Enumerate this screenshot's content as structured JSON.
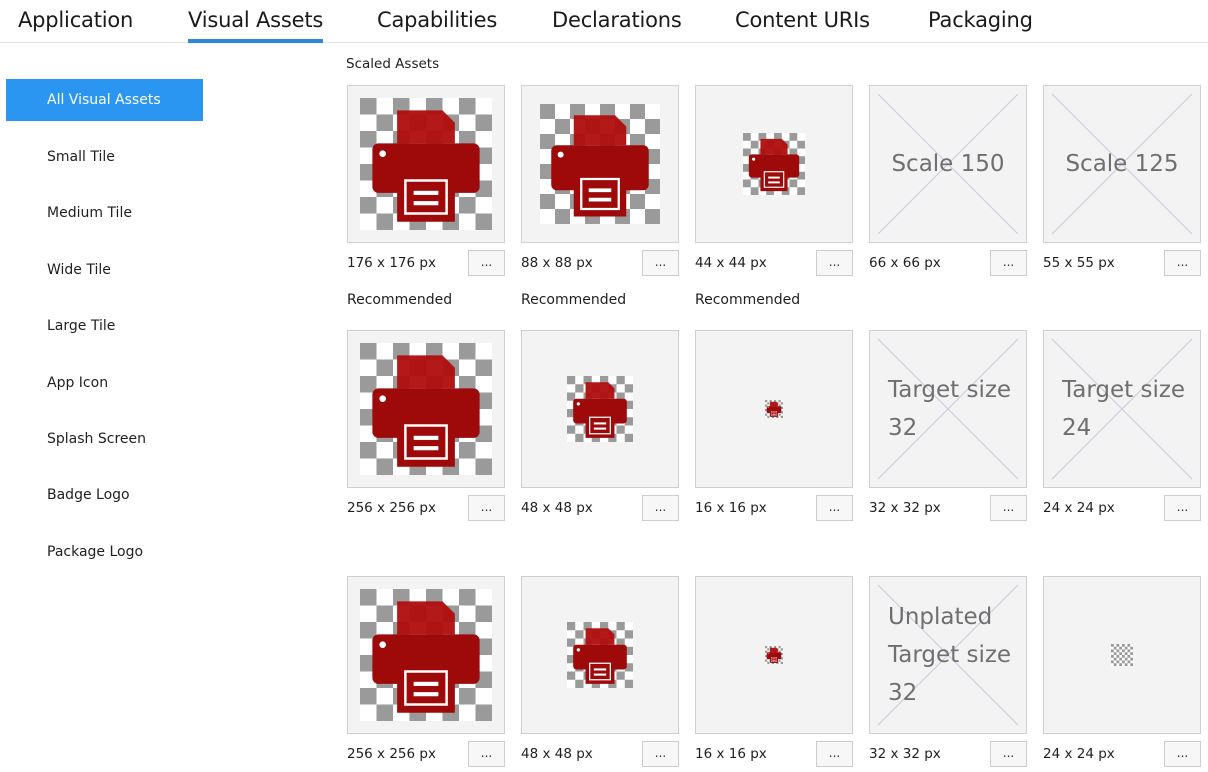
{
  "tabs": [
    {
      "label": "Application",
      "active": false
    },
    {
      "label": "Visual Assets",
      "active": true
    },
    {
      "label": "Capabilities",
      "active": false
    },
    {
      "label": "Declarations",
      "active": false
    },
    {
      "label": "Content URIs",
      "active": false
    },
    {
      "label": "Packaging",
      "active": false
    }
  ],
  "sidebar": {
    "selected": "All Visual Assets",
    "items": [
      {
        "label": "All Visual Assets"
      },
      {
        "label": "Small Tile"
      },
      {
        "label": "Medium Tile"
      },
      {
        "label": "Wide Tile"
      },
      {
        "label": "Large Tile"
      },
      {
        "label": "App Icon"
      },
      {
        "label": "Splash Screen"
      },
      {
        "label": "Badge Logo"
      },
      {
        "label": "Package Logo"
      }
    ]
  },
  "main": {
    "section_title": "Scaled Assets",
    "rows": [
      {
        "tiles": [
          {
            "size": "176 x 176 px",
            "button": "...",
            "image": "printer-icon",
            "placeholder": null,
            "recommended": "Recommended"
          },
          {
            "size": "88 x 88 px",
            "button": "...",
            "image": "printer-icon",
            "placeholder": null,
            "recommended": "Recommended"
          },
          {
            "size": "44 x 44 px",
            "button": "...",
            "image": "printer-icon",
            "placeholder": null,
            "recommended": "Recommended"
          },
          {
            "size": "66 x 66 px",
            "button": "...",
            "image": null,
            "placeholder": "Scale 150",
            "recommended": null
          },
          {
            "size": "55 x 55 px",
            "button": "...",
            "image": null,
            "placeholder": "Scale 125",
            "recommended": null
          }
        ]
      },
      {
        "tiles": [
          {
            "size": "256 x 256 px",
            "button": "...",
            "image": "printer-icon",
            "placeholder": null
          },
          {
            "size": "48 x 48 px",
            "button": "...",
            "image": "printer-icon",
            "placeholder": null
          },
          {
            "size": "16 x 16 px",
            "button": "...",
            "image": "printer-icon",
            "placeholder": null
          },
          {
            "size": "32 x 32 px",
            "button": "...",
            "image": null,
            "placeholder": "Target size 32"
          },
          {
            "size": "24 x 24 px",
            "button": "...",
            "image": null,
            "placeholder": "Target size 24"
          }
        ]
      },
      {
        "tiles": [
          {
            "size": "256 x 256 px",
            "button": "...",
            "image": "printer-icon",
            "placeholder": null
          },
          {
            "size": "48 x 48 px",
            "button": "...",
            "image": "printer-icon",
            "placeholder": null
          },
          {
            "size": "16 x 16 px",
            "button": "...",
            "image": "printer-icon",
            "placeholder": null
          },
          {
            "size": "32 x 32 px",
            "button": "...",
            "image": null,
            "placeholder": "Unplated Target size 32"
          },
          {
            "size": "24 x 24 px",
            "button": "...",
            "image": "transparent-checker",
            "placeholder": null
          }
        ]
      }
    ]
  },
  "colors": {
    "accent": "#2b95f2",
    "tab_underline": "#2f86e0",
    "icon_red": "#9e0a0a",
    "checker_dark": "#9a9a9a",
    "checker_light": "#ffffff",
    "tile_bg": "#f3f3f3",
    "placeholder_text": "#6f6f6f"
  }
}
